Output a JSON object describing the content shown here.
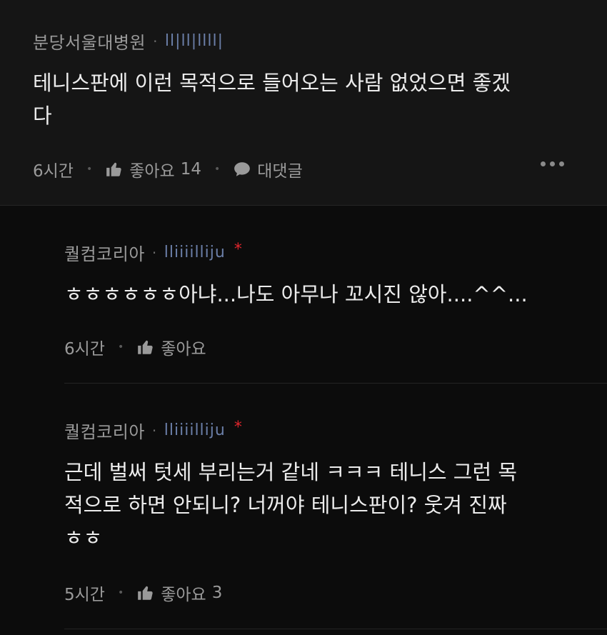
{
  "comments": [
    {
      "author": "분당서울대병원",
      "handle": "ll|ll|llll|",
      "text": "테니스판에 이런 목적으로 들어오는 사람 없었으면 좋겠\n다",
      "time": "6시간",
      "like_label": "좋아요",
      "like_count": "14",
      "reply_label": "대댓글"
    },
    {
      "author": "퀄컴코리아",
      "handle": "lliiiilliju",
      "star": "*",
      "text": "ㅎㅎㅎㅎㅎㅎ아냐...나도 아무나 꼬시진 않아....^^...",
      "time": "6시간",
      "like_label": "좋아요",
      "like_count": ""
    },
    {
      "author": "퀄컴코리아",
      "handle": "lliiiilliju",
      "star": "*",
      "text": "근데 벌써 텃세 부리는거 같네 ㅋㅋㅋ 테니스 그런 목\n적으로 하면 안되니? 너꺼야 테니스판이? 웃겨 진짜\nㅎㅎ",
      "time": "5시간",
      "like_label": "좋아요",
      "like_count": "3"
    }
  ],
  "icons": {
    "like": "thumbs-up-icon",
    "reply": "speech-bubble-icon",
    "more": "more-dots-icon"
  },
  "colors": {
    "background": "#0c0c0c",
    "top_block": "#151515",
    "handle": "#6b7fa8",
    "star": "#e0262d"
  }
}
